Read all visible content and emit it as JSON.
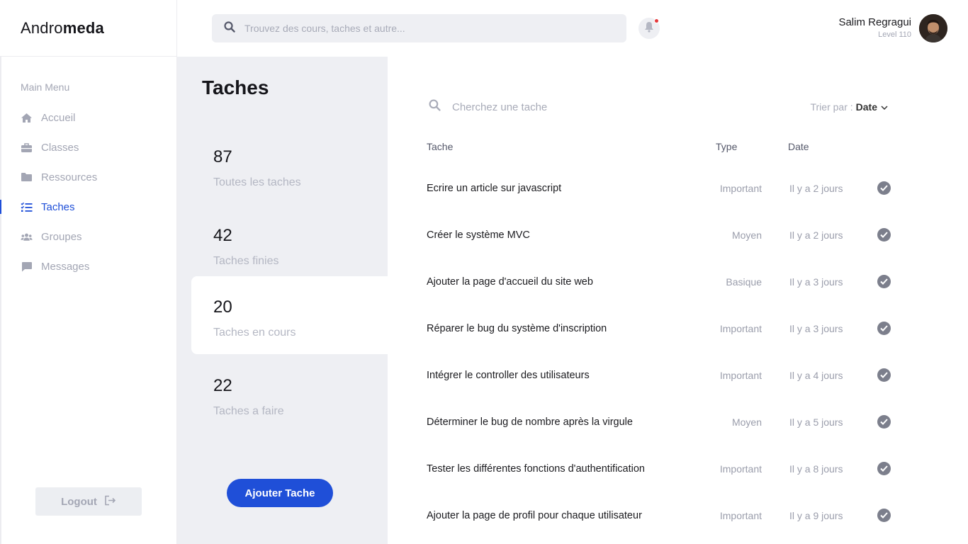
{
  "app": {
    "logo_part1": "Andro",
    "logo_part2": "meda"
  },
  "search": {
    "placeholder": "Trouvez des cours, taches et autre..."
  },
  "user": {
    "name": "Salim Regragui",
    "level": "Level 110"
  },
  "sidebar": {
    "menu_title": "Main Menu",
    "items": [
      {
        "label": "Accueil",
        "icon": "home-icon"
      },
      {
        "label": "Classes",
        "icon": "briefcase-icon"
      },
      {
        "label": "Ressources",
        "icon": "folder-icon"
      },
      {
        "label": "Taches",
        "icon": "task-list-icon",
        "active": true
      },
      {
        "label": "Groupes",
        "icon": "users-icon"
      },
      {
        "label": "Messages",
        "icon": "chat-icon"
      }
    ],
    "logout_label": "Logout"
  },
  "stats": {
    "title": "Taches",
    "cards": [
      {
        "value": "87",
        "label": "Toutes les taches"
      },
      {
        "value": "42",
        "label": "Taches finies"
      },
      {
        "value": "20",
        "label": "Taches en cours",
        "active": true
      },
      {
        "value": "22",
        "label": "Taches a faire"
      }
    ],
    "add_button": "Ajouter Tache"
  },
  "tasks": {
    "search_placeholder": "Cherchez une tache",
    "sort_label": "Trier par :",
    "sort_value": "Date",
    "columns": {
      "task": "Tache",
      "type": "Type",
      "date": "Date"
    },
    "rows": [
      {
        "name": "Ecrire un article sur  javascript",
        "type": "Important",
        "date": "Il y a 2 jours"
      },
      {
        "name": "Créer le système MVC",
        "type": "Moyen",
        "date": "Il y a 2 jours"
      },
      {
        "name": "Ajouter la page d'accueil du site web",
        "type": "Basique",
        "date": "Il y a 3 jours"
      },
      {
        "name": "Réparer le bug du système d'inscription",
        "type": "Important",
        "date": "Il y a 3 jours"
      },
      {
        "name": "Intégrer le controller des utilisateurs",
        "type": "Important",
        "date": "Il y a 4 jours"
      },
      {
        "name": "Déterminer le bug de nombre après la virgule",
        "type": "Moyen",
        "date": "Il y a 5 jours"
      },
      {
        "name": "Tester les différentes fonctions d'authentification",
        "type": "Important",
        "date": "Il y a 8 jours"
      },
      {
        "name": "Ajouter la page de profil pour chaque utilisateur",
        "type": "Important",
        "date": "Il y a 9 jours"
      }
    ]
  },
  "colors": {
    "accent": "#1f4fd8",
    "muted": "#a3a6b4",
    "panel": "#eeeff3",
    "notification": "#e5383b"
  }
}
